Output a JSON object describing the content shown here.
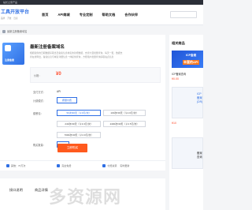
{
  "topbar": {
    "left": "站长之家产品",
    "right": ""
  },
  "header": {
    "logo_title": "工具开放平台",
    "logo_subtitle": [
      "品牌",
      "开放",
      "连接"
    ],
    "nav": [
      "首页",
      "API商城",
      "专业定制",
      "帮助文档",
      "合作伙伴"
    ],
    "search_placeholder": ""
  },
  "breadcrumb": {
    "current": "最新注册备案域名"
  },
  "product": {
    "image_caption": "注册备案",
    "title": "最新注册备案域名",
    "description": "根据提供的日期数据获取当日备案信息域名的新增数据，支持大型批量查询，每天一更，数据支持在线导出，备案信息与域名详细信息一体提供查询，方便用户批量查询获取站点信息"
  },
  "price": {
    "label": "价格：",
    "value": "¥0"
  },
  "spec": {
    "api_label": "支付方式：",
    "api_value": "API",
    "pay_label": "计费模式：",
    "pay_option": "按量付费",
    "package_label": "套餐包：",
    "packages": [
      "50次/30天（￥0元/次）",
      "100次/30天（￥2.0元/次）",
      "240次/30天（￥3.3元/次）",
      "2400次/30天（￥2.5元/次）",
      "7000次/30天（￥2.9元/次）"
    ],
    "quantity_label": "购买数量：",
    "quantity": "1",
    "buy_label": "立即购买"
  },
  "info_bar": [
    "其他：70万次",
    "",
    "完全免费",
    "付费资源",
    "实时更新"
  ],
  "tabs": [
    "接口说明",
    "商品详情"
  ],
  "sidebar": {
    "title": "相关商品",
    "ad1_line1": "ICP备案",
    "ad1_line2": "丰富的API",
    "item1_title": "ICP备案查询",
    "item1_price": "¥0.00",
    "ad2_text": "ICP备案\n(DR)",
    "item2_price": "¥10",
    "ad3_text": "备案查询"
  },
  "watermark": "多资源网"
}
